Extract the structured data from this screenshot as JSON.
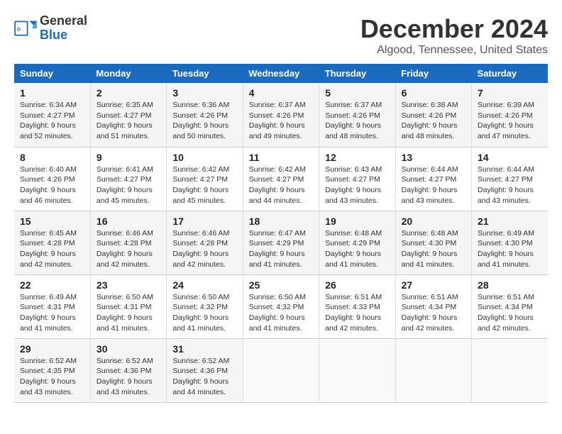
{
  "logo": {
    "text_general": "General",
    "text_blue": "Blue"
  },
  "title": "December 2024",
  "subtitle": "Algood, Tennessee, United States",
  "days_of_week": [
    "Sunday",
    "Monday",
    "Tuesday",
    "Wednesday",
    "Thursday",
    "Friday",
    "Saturday"
  ],
  "weeks": [
    [
      {
        "day": "1",
        "sunrise": "Sunrise: 6:34 AM",
        "sunset": "Sunset: 4:27 PM",
        "daylight": "Daylight: 9 hours and 52 minutes."
      },
      {
        "day": "2",
        "sunrise": "Sunrise: 6:35 AM",
        "sunset": "Sunset: 4:27 PM",
        "daylight": "Daylight: 9 hours and 51 minutes."
      },
      {
        "day": "3",
        "sunrise": "Sunrise: 6:36 AM",
        "sunset": "Sunset: 4:26 PM",
        "daylight": "Daylight: 9 hours and 50 minutes."
      },
      {
        "day": "4",
        "sunrise": "Sunrise: 6:37 AM",
        "sunset": "Sunset: 4:26 PM",
        "daylight": "Daylight: 9 hours and 49 minutes."
      },
      {
        "day": "5",
        "sunrise": "Sunrise: 6:37 AM",
        "sunset": "Sunset: 4:26 PM",
        "daylight": "Daylight: 9 hours and 48 minutes."
      },
      {
        "day": "6",
        "sunrise": "Sunrise: 6:38 AM",
        "sunset": "Sunset: 4:26 PM",
        "daylight": "Daylight: 9 hours and 48 minutes."
      },
      {
        "day": "7",
        "sunrise": "Sunrise: 6:39 AM",
        "sunset": "Sunset: 4:26 PM",
        "daylight": "Daylight: 9 hours and 47 minutes."
      }
    ],
    [
      {
        "day": "8",
        "sunrise": "Sunrise: 6:40 AM",
        "sunset": "Sunset: 4:26 PM",
        "daylight": "Daylight: 9 hours and 46 minutes."
      },
      {
        "day": "9",
        "sunrise": "Sunrise: 6:41 AM",
        "sunset": "Sunset: 4:27 PM",
        "daylight": "Daylight: 9 hours and 45 minutes."
      },
      {
        "day": "10",
        "sunrise": "Sunrise: 6:42 AM",
        "sunset": "Sunset: 4:27 PM",
        "daylight": "Daylight: 9 hours and 45 minutes."
      },
      {
        "day": "11",
        "sunrise": "Sunrise: 6:42 AM",
        "sunset": "Sunset: 4:27 PM",
        "daylight": "Daylight: 9 hours and 44 minutes."
      },
      {
        "day": "12",
        "sunrise": "Sunrise: 6:43 AM",
        "sunset": "Sunset: 4:27 PM",
        "daylight": "Daylight: 9 hours and 43 minutes."
      },
      {
        "day": "13",
        "sunrise": "Sunrise: 6:44 AM",
        "sunset": "Sunset: 4:27 PM",
        "daylight": "Daylight: 9 hours and 43 minutes."
      },
      {
        "day": "14",
        "sunrise": "Sunrise: 6:44 AM",
        "sunset": "Sunset: 4:27 PM",
        "daylight": "Daylight: 9 hours and 43 minutes."
      }
    ],
    [
      {
        "day": "15",
        "sunrise": "Sunrise: 6:45 AM",
        "sunset": "Sunset: 4:28 PM",
        "daylight": "Daylight: 9 hours and 42 minutes."
      },
      {
        "day": "16",
        "sunrise": "Sunrise: 6:46 AM",
        "sunset": "Sunset: 4:28 PM",
        "daylight": "Daylight: 9 hours and 42 minutes."
      },
      {
        "day": "17",
        "sunrise": "Sunrise: 6:46 AM",
        "sunset": "Sunset: 4:28 PM",
        "daylight": "Daylight: 9 hours and 42 minutes."
      },
      {
        "day": "18",
        "sunrise": "Sunrise: 6:47 AM",
        "sunset": "Sunset: 4:29 PM",
        "daylight": "Daylight: 9 hours and 41 minutes."
      },
      {
        "day": "19",
        "sunrise": "Sunrise: 6:48 AM",
        "sunset": "Sunset: 4:29 PM",
        "daylight": "Daylight: 9 hours and 41 minutes."
      },
      {
        "day": "20",
        "sunrise": "Sunrise: 6:48 AM",
        "sunset": "Sunset: 4:30 PM",
        "daylight": "Daylight: 9 hours and 41 minutes."
      },
      {
        "day": "21",
        "sunrise": "Sunrise: 6:49 AM",
        "sunset": "Sunset: 4:30 PM",
        "daylight": "Daylight: 9 hours and 41 minutes."
      }
    ],
    [
      {
        "day": "22",
        "sunrise": "Sunrise: 6:49 AM",
        "sunset": "Sunset: 4:31 PM",
        "daylight": "Daylight: 9 hours and 41 minutes."
      },
      {
        "day": "23",
        "sunrise": "Sunrise: 6:50 AM",
        "sunset": "Sunset: 4:31 PM",
        "daylight": "Daylight: 9 hours and 41 minutes."
      },
      {
        "day": "24",
        "sunrise": "Sunrise: 6:50 AM",
        "sunset": "Sunset: 4:32 PM",
        "daylight": "Daylight: 9 hours and 41 minutes."
      },
      {
        "day": "25",
        "sunrise": "Sunrise: 6:50 AM",
        "sunset": "Sunset: 4:32 PM",
        "daylight": "Daylight: 9 hours and 41 minutes."
      },
      {
        "day": "26",
        "sunrise": "Sunrise: 6:51 AM",
        "sunset": "Sunset: 4:33 PM",
        "daylight": "Daylight: 9 hours and 42 minutes."
      },
      {
        "day": "27",
        "sunrise": "Sunrise: 6:51 AM",
        "sunset": "Sunset: 4:34 PM",
        "daylight": "Daylight: 9 hours and 42 minutes."
      },
      {
        "day": "28",
        "sunrise": "Sunrise: 6:51 AM",
        "sunset": "Sunset: 4:34 PM",
        "daylight": "Daylight: 9 hours and 42 minutes."
      }
    ],
    [
      {
        "day": "29",
        "sunrise": "Sunrise: 6:52 AM",
        "sunset": "Sunset: 4:35 PM",
        "daylight": "Daylight: 9 hours and 43 minutes."
      },
      {
        "day": "30",
        "sunrise": "Sunrise: 6:52 AM",
        "sunset": "Sunset: 4:36 PM",
        "daylight": "Daylight: 9 hours and 43 minutes."
      },
      {
        "day": "31",
        "sunrise": "Sunrise: 6:52 AM",
        "sunset": "Sunset: 4:36 PM",
        "daylight": "Daylight: 9 hours and 44 minutes."
      },
      null,
      null,
      null,
      null
    ]
  ]
}
